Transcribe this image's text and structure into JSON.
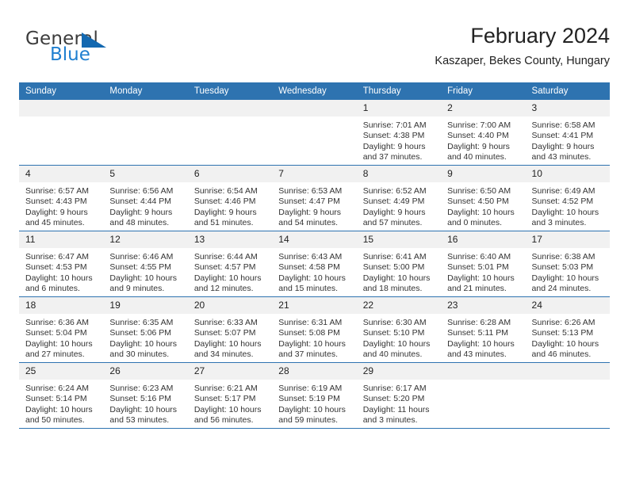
{
  "brand": {
    "name_part1": "General",
    "name_part2": "Blue",
    "triangle_color": "#1368b0",
    "blue_color": "#1f7fd0"
  },
  "header": {
    "title": "February 2024",
    "subtitle": "Kaszaper, Bekes County, Hungary"
  },
  "theme": {
    "header_blue": "#2e73b0",
    "daynum_bg": "#f1f1f1",
    "text": "#222222"
  },
  "calendar": {
    "weekday_headers": [
      "Sunday",
      "Monday",
      "Tuesday",
      "Wednesday",
      "Thursday",
      "Friday",
      "Saturday"
    ],
    "weeks": [
      [
        {
          "day": "",
          "sunrise": "",
          "sunset": "",
          "daylight_line1": "",
          "daylight_line2": ""
        },
        {
          "day": "",
          "sunrise": "",
          "sunset": "",
          "daylight_line1": "",
          "daylight_line2": ""
        },
        {
          "day": "",
          "sunrise": "",
          "sunset": "",
          "daylight_line1": "",
          "daylight_line2": ""
        },
        {
          "day": "",
          "sunrise": "",
          "sunset": "",
          "daylight_line1": "",
          "daylight_line2": ""
        },
        {
          "day": "1",
          "sunrise": "Sunrise: 7:01 AM",
          "sunset": "Sunset: 4:38 PM",
          "daylight_line1": "Daylight: 9 hours",
          "daylight_line2": "and 37 minutes."
        },
        {
          "day": "2",
          "sunrise": "Sunrise: 7:00 AM",
          "sunset": "Sunset: 4:40 PM",
          "daylight_line1": "Daylight: 9 hours",
          "daylight_line2": "and 40 minutes."
        },
        {
          "day": "3",
          "sunrise": "Sunrise: 6:58 AM",
          "sunset": "Sunset: 4:41 PM",
          "daylight_line1": "Daylight: 9 hours",
          "daylight_line2": "and 43 minutes."
        }
      ],
      [
        {
          "day": "4",
          "sunrise": "Sunrise: 6:57 AM",
          "sunset": "Sunset: 4:43 PM",
          "daylight_line1": "Daylight: 9 hours",
          "daylight_line2": "and 45 minutes."
        },
        {
          "day": "5",
          "sunrise": "Sunrise: 6:56 AM",
          "sunset": "Sunset: 4:44 PM",
          "daylight_line1": "Daylight: 9 hours",
          "daylight_line2": "and 48 minutes."
        },
        {
          "day": "6",
          "sunrise": "Sunrise: 6:54 AM",
          "sunset": "Sunset: 4:46 PM",
          "daylight_line1": "Daylight: 9 hours",
          "daylight_line2": "and 51 minutes."
        },
        {
          "day": "7",
          "sunrise": "Sunrise: 6:53 AM",
          "sunset": "Sunset: 4:47 PM",
          "daylight_line1": "Daylight: 9 hours",
          "daylight_line2": "and 54 minutes."
        },
        {
          "day": "8",
          "sunrise": "Sunrise: 6:52 AM",
          "sunset": "Sunset: 4:49 PM",
          "daylight_line1": "Daylight: 9 hours",
          "daylight_line2": "and 57 minutes."
        },
        {
          "day": "9",
          "sunrise": "Sunrise: 6:50 AM",
          "sunset": "Sunset: 4:50 PM",
          "daylight_line1": "Daylight: 10 hours",
          "daylight_line2": "and 0 minutes."
        },
        {
          "day": "10",
          "sunrise": "Sunrise: 6:49 AM",
          "sunset": "Sunset: 4:52 PM",
          "daylight_line1": "Daylight: 10 hours",
          "daylight_line2": "and 3 minutes."
        }
      ],
      [
        {
          "day": "11",
          "sunrise": "Sunrise: 6:47 AM",
          "sunset": "Sunset: 4:53 PM",
          "daylight_line1": "Daylight: 10 hours",
          "daylight_line2": "and 6 minutes."
        },
        {
          "day": "12",
          "sunrise": "Sunrise: 6:46 AM",
          "sunset": "Sunset: 4:55 PM",
          "daylight_line1": "Daylight: 10 hours",
          "daylight_line2": "and 9 minutes."
        },
        {
          "day": "13",
          "sunrise": "Sunrise: 6:44 AM",
          "sunset": "Sunset: 4:57 PM",
          "daylight_line1": "Daylight: 10 hours",
          "daylight_line2": "and 12 minutes."
        },
        {
          "day": "14",
          "sunrise": "Sunrise: 6:43 AM",
          "sunset": "Sunset: 4:58 PM",
          "daylight_line1": "Daylight: 10 hours",
          "daylight_line2": "and 15 minutes."
        },
        {
          "day": "15",
          "sunrise": "Sunrise: 6:41 AM",
          "sunset": "Sunset: 5:00 PM",
          "daylight_line1": "Daylight: 10 hours",
          "daylight_line2": "and 18 minutes."
        },
        {
          "day": "16",
          "sunrise": "Sunrise: 6:40 AM",
          "sunset": "Sunset: 5:01 PM",
          "daylight_line1": "Daylight: 10 hours",
          "daylight_line2": "and 21 minutes."
        },
        {
          "day": "17",
          "sunrise": "Sunrise: 6:38 AM",
          "sunset": "Sunset: 5:03 PM",
          "daylight_line1": "Daylight: 10 hours",
          "daylight_line2": "and 24 minutes."
        }
      ],
      [
        {
          "day": "18",
          "sunrise": "Sunrise: 6:36 AM",
          "sunset": "Sunset: 5:04 PM",
          "daylight_line1": "Daylight: 10 hours",
          "daylight_line2": "and 27 minutes."
        },
        {
          "day": "19",
          "sunrise": "Sunrise: 6:35 AM",
          "sunset": "Sunset: 5:06 PM",
          "daylight_line1": "Daylight: 10 hours",
          "daylight_line2": "and 30 minutes."
        },
        {
          "day": "20",
          "sunrise": "Sunrise: 6:33 AM",
          "sunset": "Sunset: 5:07 PM",
          "daylight_line1": "Daylight: 10 hours",
          "daylight_line2": "and 34 minutes."
        },
        {
          "day": "21",
          "sunrise": "Sunrise: 6:31 AM",
          "sunset": "Sunset: 5:08 PM",
          "daylight_line1": "Daylight: 10 hours",
          "daylight_line2": "and 37 minutes."
        },
        {
          "day": "22",
          "sunrise": "Sunrise: 6:30 AM",
          "sunset": "Sunset: 5:10 PM",
          "daylight_line1": "Daylight: 10 hours",
          "daylight_line2": "and 40 minutes."
        },
        {
          "day": "23",
          "sunrise": "Sunrise: 6:28 AM",
          "sunset": "Sunset: 5:11 PM",
          "daylight_line1": "Daylight: 10 hours",
          "daylight_line2": "and 43 minutes."
        },
        {
          "day": "24",
          "sunrise": "Sunrise: 6:26 AM",
          "sunset": "Sunset: 5:13 PM",
          "daylight_line1": "Daylight: 10 hours",
          "daylight_line2": "and 46 minutes."
        }
      ],
      [
        {
          "day": "25",
          "sunrise": "Sunrise: 6:24 AM",
          "sunset": "Sunset: 5:14 PM",
          "daylight_line1": "Daylight: 10 hours",
          "daylight_line2": "and 50 minutes."
        },
        {
          "day": "26",
          "sunrise": "Sunrise: 6:23 AM",
          "sunset": "Sunset: 5:16 PM",
          "daylight_line1": "Daylight: 10 hours",
          "daylight_line2": "and 53 minutes."
        },
        {
          "day": "27",
          "sunrise": "Sunrise: 6:21 AM",
          "sunset": "Sunset: 5:17 PM",
          "daylight_line1": "Daylight: 10 hours",
          "daylight_line2": "and 56 minutes."
        },
        {
          "day": "28",
          "sunrise": "Sunrise: 6:19 AM",
          "sunset": "Sunset: 5:19 PM",
          "daylight_line1": "Daylight: 10 hours",
          "daylight_line2": "and 59 minutes."
        },
        {
          "day": "29",
          "sunrise": "Sunrise: 6:17 AM",
          "sunset": "Sunset: 5:20 PM",
          "daylight_line1": "Daylight: 11 hours",
          "daylight_line2": "and 3 minutes."
        },
        {
          "day": "",
          "sunrise": "",
          "sunset": "",
          "daylight_line1": "",
          "daylight_line2": ""
        },
        {
          "day": "",
          "sunrise": "",
          "sunset": "",
          "daylight_line1": "",
          "daylight_line2": ""
        }
      ]
    ]
  }
}
